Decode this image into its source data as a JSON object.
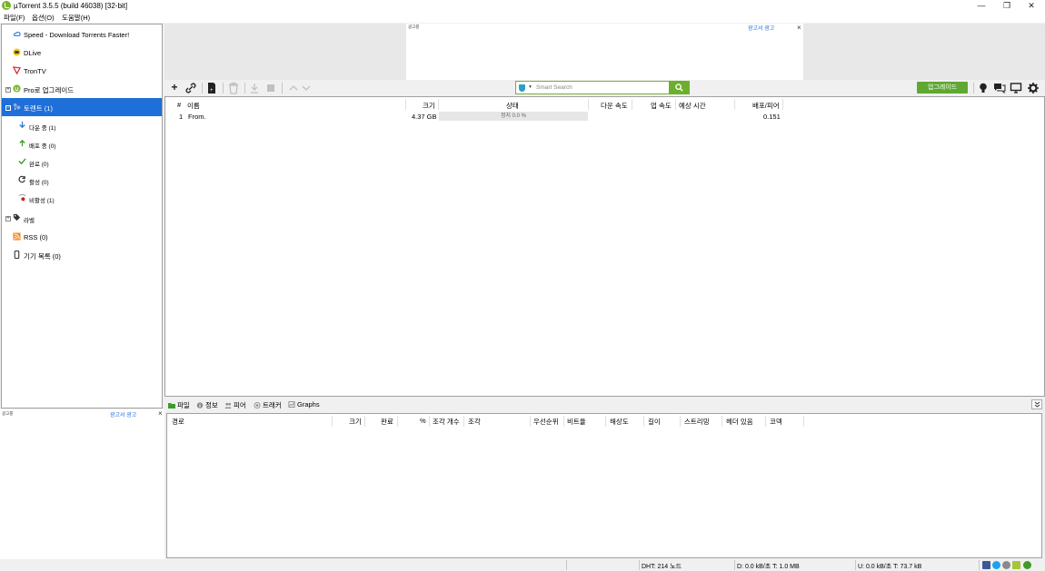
{
  "window": {
    "title": "µTorrent 3.5.5  (build 46038) [32-bit]",
    "minimize": "—",
    "maximize": "❐",
    "close": "✕"
  },
  "menu": [
    "파일(F)",
    "옵션(O)",
    "도움말(H)"
  ],
  "sidebar": {
    "items": [
      {
        "label": "Speed - Download Torrents Faster!",
        "icon": "speed-cloud-icon"
      },
      {
        "label": "DLive",
        "icon": "dlive-icon"
      },
      {
        "label": "TronTV",
        "icon": "trontv-icon"
      },
      {
        "label": "Pro로 업그레이드",
        "icon": "utorrent-pro-icon"
      },
      {
        "label": "토렌트 (1)",
        "icon": "torrents-icon"
      },
      {
        "label": "다운 중 (1)",
        "icon": "download-arrow-icon"
      },
      {
        "label": "배포 중 (0)",
        "icon": "upload-arrow-icon"
      },
      {
        "label": "완료 (0)",
        "icon": "checkmark-icon"
      },
      {
        "label": "활성 (0)",
        "icon": "refresh-icon"
      },
      {
        "label": "비활성 (1)",
        "icon": "inactive-icon"
      },
      {
        "label": "라벨",
        "icon": "label-tag-icon"
      },
      {
        "label": "RSS (0)",
        "icon": "rss-icon"
      },
      {
        "label": "기기 목록 (0)",
        "icon": "device-icon"
      }
    ],
    "ad_label": "광고를",
    "ad_link": "광고서 광고",
    "ad_close": "×"
  },
  "top_ad": {
    "label": "광고를",
    "link": "광고서 광고",
    "close": "×"
  },
  "toolbar": {
    "search_placeholder": "Smart Search",
    "search_icon": "🔍",
    "upgrade_label": "업그레이드",
    "icons": [
      "add-torrent-icon",
      "add-url-icon",
      "create-torrent-icon",
      "remove-icon",
      "start-icon",
      "stop-icon",
      "move-up-icon",
      "move-down-icon",
      "lightbulb-icon",
      "chat-icon",
      "remote-icon",
      "settings-icon"
    ]
  },
  "torrent_table": {
    "headers": [
      "#",
      "이름",
      "크기",
      "상태",
      "다운 속도",
      "업 속도",
      "예상 시간",
      "배포/피어"
    ],
    "rows": [
      {
        "num": "1",
        "name": "From.",
        "size": "4.37 GB",
        "status": "정지 0.0 %",
        "down": "",
        "up": "",
        "eta": "",
        "ratio": "0.151"
      }
    ]
  },
  "detail_tabs": [
    {
      "label": "파일",
      "icon": "files-folder-icon"
    },
    {
      "label": "정보",
      "icon": "info-icon"
    },
    {
      "label": "피어",
      "icon": "peers-icon"
    },
    {
      "label": "트래커",
      "icon": "trackers-icon"
    },
    {
      "label": "Graphs",
      "icon": "graphs-icon"
    }
  ],
  "files_table": {
    "headers": [
      "경로",
      "크기",
      "완료",
      "%",
      "조각 개수",
      "조각",
      "우선순위",
      "비트율",
      "해상도",
      "길이",
      "스트리밍",
      "헤더 있음",
      "코덱"
    ]
  },
  "statusbar": {
    "dht": "DHT: 214 노드",
    "down": "D: 0.0 kB/초 T: 1.0 MB",
    "up": "U: 0.0 kB/초 T: 73.7 kB"
  },
  "colors": {
    "accent": "#78b32a",
    "selection": "#1e6fd9",
    "link": "#1e6fd9"
  }
}
